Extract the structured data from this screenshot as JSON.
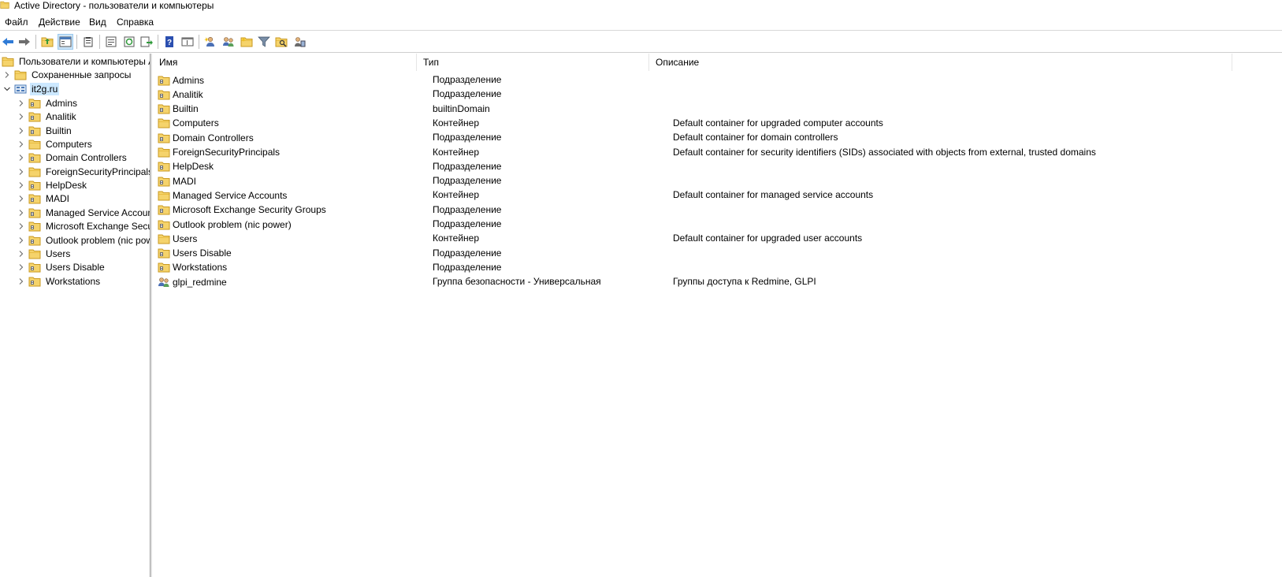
{
  "window": {
    "title": "Active Directory - пользователи и компьютеры"
  },
  "menu": {
    "items": [
      "Файл",
      "Действие",
      "Вид",
      "Справка"
    ]
  },
  "toolbar": {
    "buttons": [
      "back-icon",
      "forward-icon",
      "up-folder-icon",
      "show-tree-icon",
      "clipboard-icon",
      "properties-icon",
      "refresh-icon",
      "export-list-icon",
      "help-icon",
      "console-icon",
      "new-user-icon",
      "new-group-icon",
      "new-ou-icon",
      "filter-icon",
      "find-icon",
      "delegate-icon"
    ]
  },
  "tree": {
    "root_label": "Пользователи и компьютеры A",
    "saved_queries": "Сохраненные запросы",
    "domain": "it2g.ru",
    "children": [
      "Admins",
      "Analitik",
      "Builtin",
      "Computers",
      "Domain Controllers",
      "ForeignSecurityPrincipals",
      "HelpDesk",
      "MADI",
      "Managed Service Accounts",
      "Microsoft Exchange Security Groups",
      "Outlook problem (nic power)",
      "Users",
      "Users Disable",
      "Workstations"
    ]
  },
  "list": {
    "columns": [
      "Имя",
      "Тип",
      "Описание"
    ],
    "rows": [
      {
        "name": "Admins",
        "type": "Подразделение",
        "description": ""
      },
      {
        "name": "Analitik",
        "type": "Подразделение",
        "description": ""
      },
      {
        "name": "Builtin",
        "type": "builtinDomain",
        "description": ""
      },
      {
        "name": "Computers",
        "type": "Контейнер",
        "description": "Default container for upgraded computer accounts"
      },
      {
        "name": "Domain Controllers",
        "type": "Подразделение",
        "description": "Default container for domain controllers"
      },
      {
        "name": "ForeignSecurityPrincipals",
        "type": "Контейнер",
        "description": "Default container for security identifiers (SIDs) associated with objects from external, trusted domains"
      },
      {
        "name": "HelpDesk",
        "type": "Подразделение",
        "description": ""
      },
      {
        "name": "MADI",
        "type": "Подразделение",
        "description": ""
      },
      {
        "name": "Managed Service Accounts",
        "type": "Контейнер",
        "description": "Default container for managed service accounts"
      },
      {
        "name": "Microsoft Exchange Security Groups",
        "type": "Подразделение",
        "description": ""
      },
      {
        "name": "Outlook problem (nic power)",
        "type": "Подразделение",
        "description": ""
      },
      {
        "name": "Users",
        "type": "Контейнер",
        "description": "Default container for upgraded user accounts"
      },
      {
        "name": "Users Disable",
        "type": "Подразделение",
        "description": ""
      },
      {
        "name": "Workstations",
        "type": "Подразделение",
        "description": ""
      },
      {
        "name": "glpi_redmine",
        "type": "Группа безопасности - Универсальная",
        "description": "Группы доступа к Redmine, GLPI"
      }
    ]
  },
  "colors": {
    "folder": "#f5d36b",
    "folder_dark": "#d9a92c",
    "selection": "#cce8ff",
    "arrow_blue": "#2f7bd6"
  }
}
